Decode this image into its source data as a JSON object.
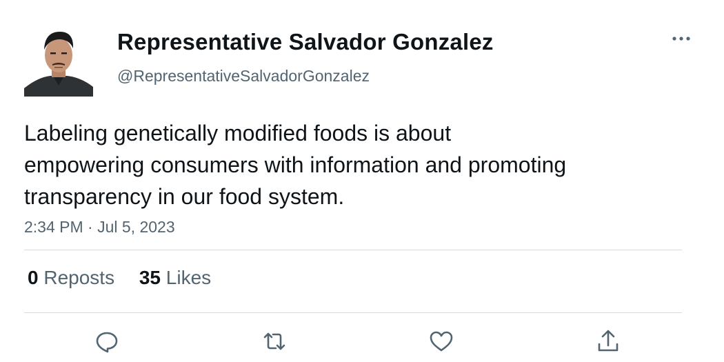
{
  "author": {
    "display_name": "Representative Salvador Gonzalez",
    "handle": "@RepresentativeSalvadorGonzalez",
    "avatar": "profile-photo"
  },
  "tweet": {
    "text_lines": [
      "Labeling genetically modified foods is about",
      "empowering consumers with information and promoting",
      "transparency in our food system."
    ],
    "timestamp": "2:34 PM · Jul 5, 2023"
  },
  "stats": {
    "reposts_count": "0",
    "reposts_label": "Reposts",
    "likes_count": "35",
    "likes_label": "Likes"
  },
  "actions": {
    "reply_icon": "reply-icon",
    "repost_icon": "repost-icon",
    "like_icon": "like-icon",
    "share_icon": "share-icon",
    "more_icon": "more-icon"
  },
  "colors": {
    "text": "#0f1419",
    "secondary": "#536471",
    "divider": "#d5d9dc"
  }
}
